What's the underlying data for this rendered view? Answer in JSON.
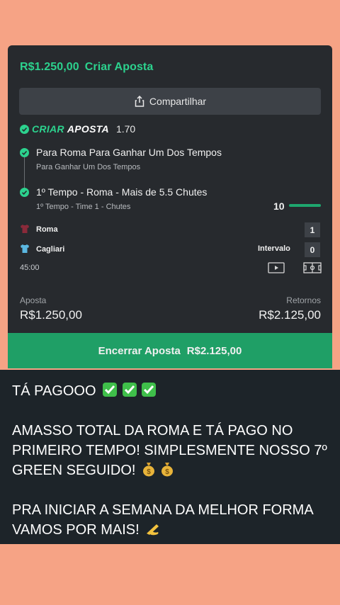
{
  "bet": {
    "stake_header": "R$1.250,00",
    "create_bet_label": "Criar Aposta",
    "share_label": "Compartilhar",
    "criar_label": "CRIAR",
    "aposta_label": "APOSTA",
    "odds": "1.70",
    "selections": [
      {
        "title": "Para Roma Para Ganhar Um Dos Tempos",
        "subtitle": "Para Ganhar Um Dos Tempos"
      },
      {
        "title": "1º Tempo - Roma - Mais de 5.5 Chutes",
        "subtitle": "1º Tempo - Time 1 - Chutes",
        "progress": "10"
      }
    ],
    "teams": [
      {
        "name": "Roma",
        "score": "1"
      },
      {
        "name": "Cagliari",
        "score": "0",
        "status": "Intervalo"
      }
    ],
    "time": "45:00",
    "stake_label": "Aposta",
    "stake_value": "R$1.250,00",
    "returns_label": "Retornos",
    "returns_value": "R$2.125,00",
    "cashout_label": "Encerrar Aposta",
    "cashout_value": "R$2.125,00"
  },
  "colors": {
    "accent": "#2cd28e",
    "cashout_bg": "#1f9f66",
    "page_bg": "#f6a385",
    "panel_bg": "#272a2e",
    "msg_bg": "#1d2429"
  },
  "message": {
    "line1": "TÁ PAGOOO",
    "line2": "AMASSO TOTAL DA ROMA E TÁ PAGO NO",
    "line3": "PRIMEIRO TEMPO! SIMPLESMENTE NOSSO 7º",
    "line4": "GREEN SEGUIDO!",
    "line5": "PRA INICIAR A SEMANA DA MELHOR FORMA",
    "line6": "VAMOS POR MAIS!"
  }
}
